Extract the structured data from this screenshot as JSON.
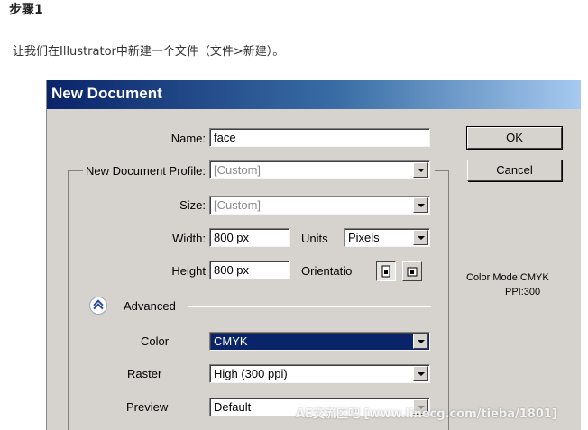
{
  "article": {
    "heading": "步骤1",
    "intro": "让我们在Illustrator中新建一个文件（文件>新建）。"
  },
  "dialog": {
    "title": "New Document",
    "name_label": "Name:",
    "name_value": "face",
    "profile_label": "New Document Profile:",
    "profile_value": "[Custom]",
    "size_label": "Size:",
    "size_value": "[Custom]",
    "width_label": "Width:",
    "width_value": "800 px",
    "units_label": "Units",
    "units_value": "Pixels",
    "height_label": "Height",
    "height_value": "800 px",
    "orientation_label": "Orientatio",
    "advanced_label": "Advanced",
    "color_label": "Color",
    "color_value": "CMYK",
    "raster_label": "Raster",
    "raster_value": "High (300 ppi)",
    "preview_label": "Preview",
    "preview_value": "Default",
    "ok_label": "OK",
    "cancel_label": "Cancel",
    "color_mode_text": "Color Mode:CMYK",
    "ppi_text": "PPI:300"
  },
  "watermark": "AE交流区吧  [www.linecg.com/tieba/1801]",
  "colors": {
    "dialog_bg": "#d6d3ce",
    "title_gradient_start": "#0a246a",
    "title_gradient_end": "#a6caf0",
    "selection": "#0a246a"
  }
}
